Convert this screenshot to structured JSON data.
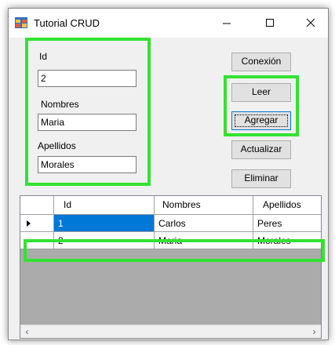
{
  "window": {
    "title": "Tutorial CRUD",
    "icons": {
      "app": "app-form-icon",
      "minimize": "minimize-icon",
      "maximize": "maximize-icon",
      "close": "close-icon"
    }
  },
  "form": {
    "id_label": "Id",
    "id_value": "2",
    "nombres_label": "Nombres",
    "nombres_value": "Maria",
    "apellidos_label": "Apellidos",
    "apellidos_value": "Morales"
  },
  "buttons": {
    "conexion": "Conexión",
    "leer": "Leer",
    "agregar": "Agregar",
    "actualizar": "Actualizar",
    "eliminar": "Eliminar"
  },
  "grid": {
    "columns": [
      "Id",
      "Nombres",
      "Apellidos"
    ],
    "rows": [
      {
        "id": "1",
        "nombres": "Carlos",
        "apellidos": "Peres",
        "current": true,
        "id_selected": true
      },
      {
        "id": "2",
        "nombres": "Maria",
        "apellidos": "Morales",
        "current": false,
        "id_selected": false
      }
    ],
    "scroll_left_icon": "chevron-left-icon",
    "scroll_right_icon": "chevron-right-icon"
  },
  "colors": {
    "highlight_green": "#33e233",
    "selection_blue": "#0078d7",
    "window_bg": "#f0f0f0"
  }
}
